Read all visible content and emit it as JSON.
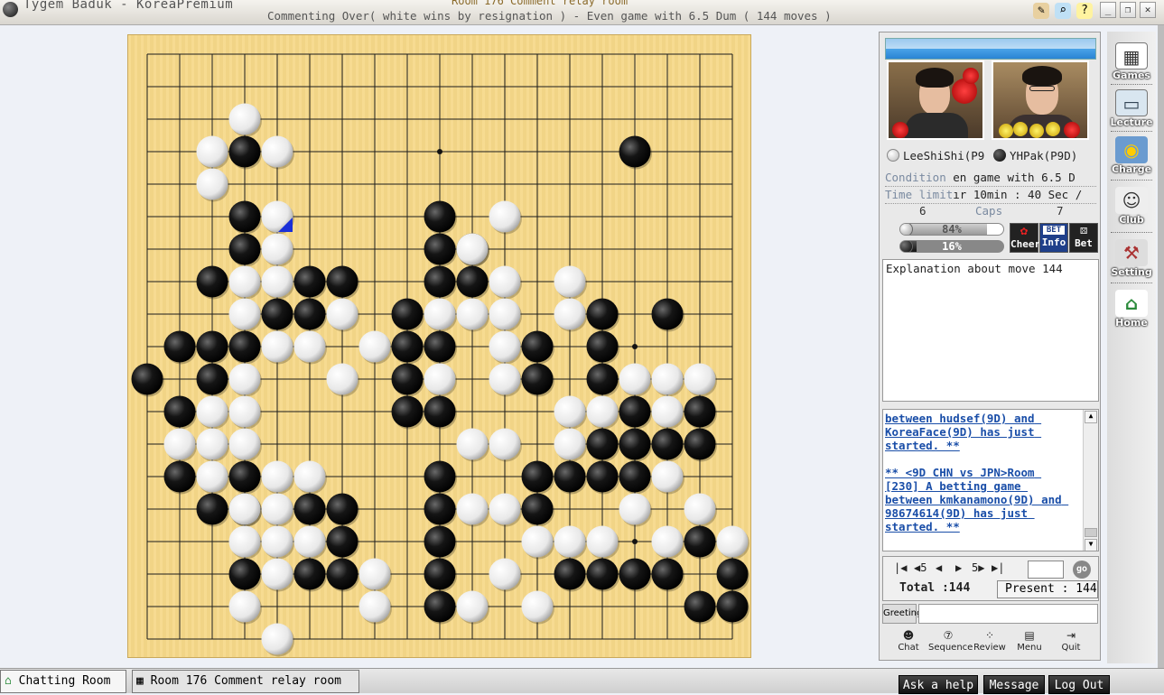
{
  "window": {
    "app_title": "Tygem Baduk - KoreaPremium",
    "room_title": "Room 176 Comment relay room",
    "comment_line": "Commenting Over( white wins by resignation ) - Even game with 6.5 Dum  ( 144 moves )",
    "controls": [
      "_",
      "❐",
      "✕"
    ]
  },
  "players": {
    "white": {
      "name": "LeeShiShi(P9"
    },
    "black": {
      "name": "YHPak(P9D)"
    }
  },
  "info": {
    "condition_label": "Condition",
    "condition_value": "en game with 6.5 D",
    "time_label": "Time limit",
    "time_value": "ır 10min : 40 Sec /",
    "caps_label": "Caps",
    "white_caps": "6",
    "black_caps": "7",
    "white_win_pct": "84%",
    "black_win_pct": "16%",
    "white_win_fraction": 0.84,
    "black_win_fraction": 0.16
  },
  "actions": {
    "cheer": "Cheer",
    "info": "Info",
    "bet": "Bet",
    "bet_badge": "BET"
  },
  "explanation": "Explanation about move 144",
  "chat": "between hudsef(9D) and KoreaFace(9D) has just started. **\n\n** <9D CHN vs JPN>Room [230] A betting game between kmkanamono(9D) and 98674614(9D) has just started. **",
  "navigation": {
    "first": "|◀",
    "back5": "◀5",
    "back1": "◀",
    "fwd1": "▶",
    "fwd5": "5▶",
    "last": "▶|",
    "go_label": "go",
    "total": "Total :144",
    "present": "Present : 144"
  },
  "greeting_label": "Greeting",
  "tools": [
    "Chat",
    "Sequence",
    "Review",
    "Menu",
    "Quit"
  ],
  "sidebar": [
    "Games",
    "Lecture",
    "Charge",
    "Club",
    "Setting",
    "Home"
  ],
  "bottom": {
    "tabs": [
      "Chatting Room",
      "Room 176 Comment relay room"
    ],
    "buttons": [
      "Ask a help",
      "Message",
      "Log Out"
    ]
  },
  "board": {
    "size": 19,
    "last_move": [
      4,
      5
    ],
    "black": [
      [
        3,
        3
      ],
      [
        15,
        3
      ],
      [
        3,
        5
      ],
      [
        9,
        5
      ],
      [
        3,
        6
      ],
      [
        2,
        7
      ],
      [
        5,
        7
      ],
      [
        6,
        7
      ],
      [
        9,
        6
      ],
      [
        10,
        6
      ],
      [
        9,
        7
      ],
      [
        10,
        7
      ],
      [
        4,
        8
      ],
      [
        5,
        8
      ],
      [
        8,
        8
      ],
      [
        14,
        8
      ],
      [
        16,
        8
      ],
      [
        1,
        9
      ],
      [
        2,
        9
      ],
      [
        3,
        9
      ],
      [
        8,
        9
      ],
      [
        9,
        9
      ],
      [
        12,
        9
      ],
      [
        14,
        9
      ],
      [
        0,
        10
      ],
      [
        2,
        10
      ],
      [
        8,
        10
      ],
      [
        12,
        10
      ],
      [
        14,
        10
      ],
      [
        1,
        11
      ],
      [
        8,
        11
      ],
      [
        9,
        11
      ],
      [
        15,
        11
      ],
      [
        17,
        11
      ],
      [
        14,
        12
      ],
      [
        15,
        12
      ],
      [
        16,
        12
      ],
      [
        17,
        12
      ],
      [
        1,
        13
      ],
      [
        3,
        13
      ],
      [
        9,
        13
      ],
      [
        12,
        13
      ],
      [
        13,
        13
      ],
      [
        14,
        13
      ],
      [
        15,
        13
      ],
      [
        2,
        14
      ],
      [
        3,
        14
      ],
      [
        5,
        14
      ],
      [
        6,
        14
      ],
      [
        9,
        14
      ],
      [
        12,
        14
      ],
      [
        6,
        15
      ],
      [
        9,
        15
      ],
      [
        17,
        15
      ],
      [
        3,
        16
      ],
      [
        5,
        16
      ],
      [
        6,
        16
      ],
      [
        9,
        16
      ],
      [
        13,
        16
      ],
      [
        14,
        16
      ],
      [
        15,
        16
      ],
      [
        16,
        16
      ],
      [
        18,
        16
      ],
      [
        9,
        17
      ],
      [
        17,
        17
      ],
      [
        18,
        17
      ]
    ],
    "white": [
      [
        3,
        2
      ],
      [
        2,
        3
      ],
      [
        4,
        3
      ],
      [
        2,
        4
      ],
      [
        4,
        5
      ],
      [
        11,
        5
      ],
      [
        4,
        6
      ],
      [
        10,
        6
      ],
      [
        11,
        7
      ],
      [
        3,
        7
      ],
      [
        4,
        7
      ],
      [
        3,
        8
      ],
      [
        6,
        8
      ],
      [
        9,
        8
      ],
      [
        10,
        8
      ],
      [
        11,
        8
      ],
      [
        13,
        7
      ],
      [
        13,
        8
      ],
      [
        4,
        9
      ],
      [
        5,
        9
      ],
      [
        7,
        9
      ],
      [
        11,
        9
      ],
      [
        3,
        10
      ],
      [
        6,
        10
      ],
      [
        9,
        10
      ],
      [
        11,
        10
      ],
      [
        15,
        10
      ],
      [
        16,
        10
      ],
      [
        17,
        10
      ],
      [
        2,
        11
      ],
      [
        3,
        11
      ],
      [
        13,
        11
      ],
      [
        14,
        11
      ],
      [
        16,
        11
      ],
      [
        1,
        12
      ],
      [
        2,
        12
      ],
      [
        3,
        12
      ],
      [
        10,
        12
      ],
      [
        11,
        12
      ],
      [
        13,
        12
      ],
      [
        2,
        13
      ],
      [
        4,
        13
      ],
      [
        5,
        13
      ],
      [
        16,
        13
      ],
      [
        3,
        14
      ],
      [
        4,
        14
      ],
      [
        10,
        14
      ],
      [
        11,
        14
      ],
      [
        15,
        14
      ],
      [
        17,
        14
      ],
      [
        3,
        15
      ],
      [
        4,
        15
      ],
      [
        5,
        15
      ],
      [
        12,
        15
      ],
      [
        13,
        15
      ],
      [
        14,
        15
      ],
      [
        16,
        15
      ],
      [
        18,
        15
      ],
      [
        4,
        16
      ],
      [
        7,
        16
      ],
      [
        11,
        16
      ],
      [
        3,
        17
      ],
      [
        7,
        17
      ],
      [
        10,
        17
      ],
      [
        12,
        17
      ],
      [
        4,
        18
      ]
    ]
  }
}
